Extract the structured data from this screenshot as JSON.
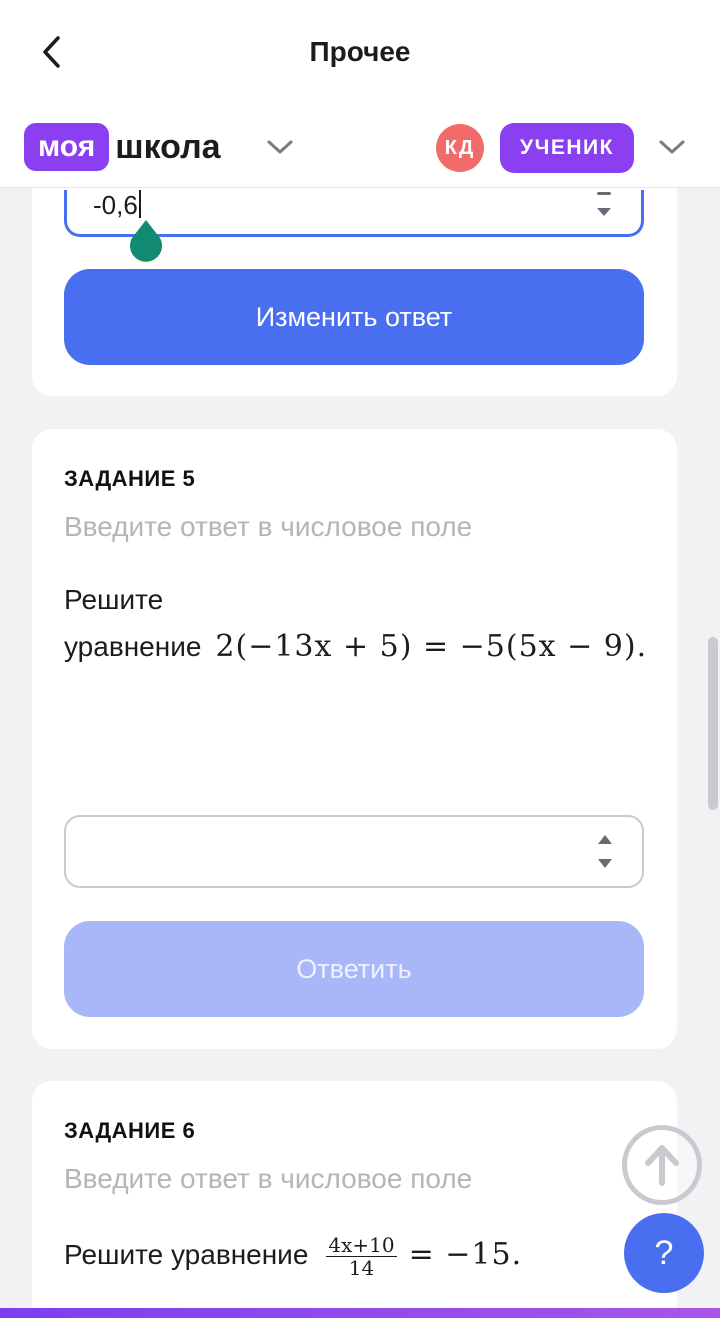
{
  "header": {
    "title": "Прочее"
  },
  "brand": {
    "logo_part1": "моя",
    "logo_part2": "школа",
    "avatar_initials": "КД",
    "role": "УЧЕНИК"
  },
  "prev_task": {
    "input_value": "-0,6",
    "button_label": "Изменить ответ"
  },
  "task5": {
    "label": "ЗАДАНИЕ 5",
    "hint": "Введите ответ в числовое поле",
    "text_line1": "Решите",
    "text_line2": "уравнение",
    "equation": "2(−13x + 5) = −5(5x − 9).",
    "input_value": "",
    "button_label": "Ответить"
  },
  "task6": {
    "label": "ЗАДАНИЕ 6",
    "hint": "Введите ответ в числовое поле",
    "text": "Решите уравнение",
    "fraction_numerator": "4x+10",
    "fraction_denominator": "14",
    "equation_rest": "= −15."
  },
  "fab": {
    "help_label": "?"
  },
  "colors": {
    "primary": "#4a6ef0",
    "primary_disabled": "#a8b7f7",
    "brand_purple": "#8a3ff0",
    "avatar": "#f26b6b",
    "drop_handle": "#128a72"
  }
}
